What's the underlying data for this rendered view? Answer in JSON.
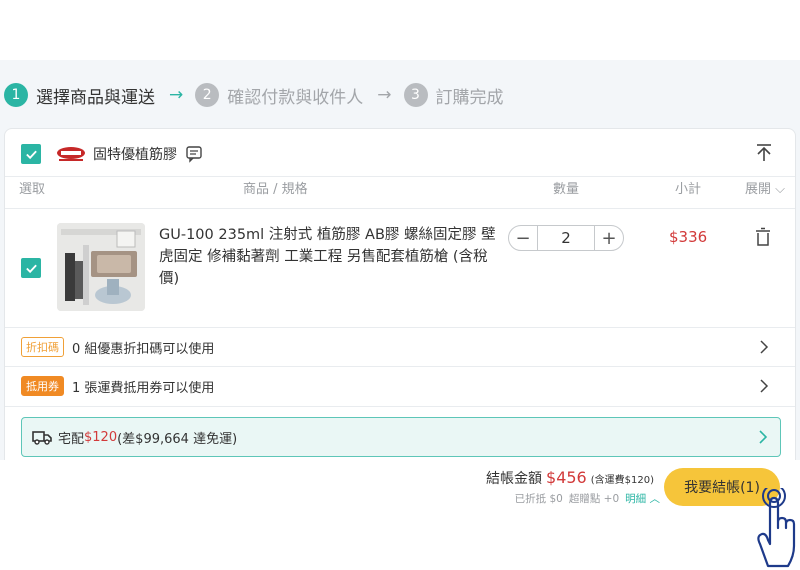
{
  "steps": [
    {
      "number": "1",
      "label": "選擇商品與運送"
    },
    {
      "number": "2",
      "label": "確認付款與收件人"
    },
    {
      "number": "3",
      "label": "訂購完成"
    }
  ],
  "store": {
    "name": "固特優植筋膠"
  },
  "columns": {
    "select": "選取",
    "product": "商品 / 規格",
    "quantity": "數量",
    "subtotal": "小計",
    "expand": "展開"
  },
  "product": {
    "title": "GU-100 235ml 注射式 植筋膠 AB膠 螺絲固定膠 壁虎固定 修補黏著劑 工業工程 另售配套植筋槍 (含稅價)",
    "quantity": "2",
    "subtotal": "$336"
  },
  "coupons": {
    "discount_tag": "折扣碼",
    "discount_text": "0 組優惠折扣碼可以使用",
    "shipping_tag": "抵用券",
    "shipping_text": "1 張運費抵用券可以使用"
  },
  "shipping": {
    "label": "宅配",
    "price": "$120",
    "note": "(差$99,664 達免運)"
  },
  "footer": {
    "total_label": "結帳金額",
    "total_amount": "$456",
    "shipping_included": "(含運費$120)",
    "discounted": "已折抵 $0",
    "bonus_points": "超贈點 +0",
    "detail_link": "明細",
    "checkout_label": "我要結帳(1)"
  },
  "colors": {
    "accent": "#2bb5a4",
    "price": "#d23a3a",
    "checkout": "#f6c53a",
    "tag": "#f08a24"
  }
}
